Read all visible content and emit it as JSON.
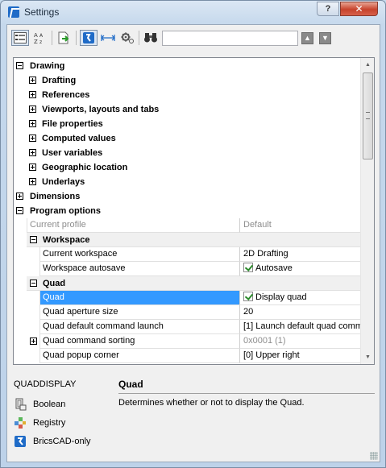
{
  "window": {
    "title": "Settings",
    "help_label": "?",
    "close_label": "✕"
  },
  "toolbar": {
    "icons": [
      "categorized-icon",
      "alphabetic-sort-icon",
      "export-icon",
      "bricscad-filter-icon",
      "width-icon",
      "settings-filter-icon",
      "binoculars-icon"
    ],
    "search_value": "",
    "prev_label": "▲",
    "next_label": "▼"
  },
  "tree": {
    "drawing": {
      "label": "Drawing",
      "children": [
        "Drafting",
        "References",
        "Viewports, layouts and tabs",
        "File properties",
        "Computed values",
        "User variables",
        "Geographic location",
        "Underlays"
      ]
    },
    "dimensions": {
      "label": "Dimensions"
    },
    "program_options": {
      "label": "Program options",
      "current_profile": {
        "name": "Current profile",
        "value": "Default"
      },
      "workspace": {
        "label": "Workspace",
        "rows": [
          {
            "name": "Current workspace",
            "value": "2D Drafting"
          },
          {
            "name": "Workspace autosave",
            "value": "Autosave",
            "checked": true
          }
        ]
      },
      "quad": {
        "label": "Quad",
        "rows": [
          {
            "name": "Quad",
            "value": "Display quad",
            "checked": true,
            "selected": true
          },
          {
            "name": "Quad aperture size",
            "value": "20"
          },
          {
            "name": "Quad default command launch",
            "value": "[1] Launch default quad comm"
          },
          {
            "name": "Quad command sorting",
            "value": "0x0001 (1)",
            "expandable": true,
            "grey": true
          },
          {
            "name": "Quad popup corner",
            "value": "[0] Upper right"
          }
        ]
      }
    }
  },
  "info": {
    "variable_name": "QUADDISPLAY",
    "title": "Quad",
    "description": "Determines whether or not to display the Quad.",
    "meta": [
      {
        "icon": "boolean-icon",
        "label": "Boolean"
      },
      {
        "icon": "registry-icon",
        "label": "Registry"
      },
      {
        "icon": "bricscad-icon",
        "label": "BricsCAD-only"
      }
    ]
  },
  "colors": {
    "selection": "#3399ff",
    "close_button": "#c7432c",
    "frame": "#c5d8ec"
  }
}
